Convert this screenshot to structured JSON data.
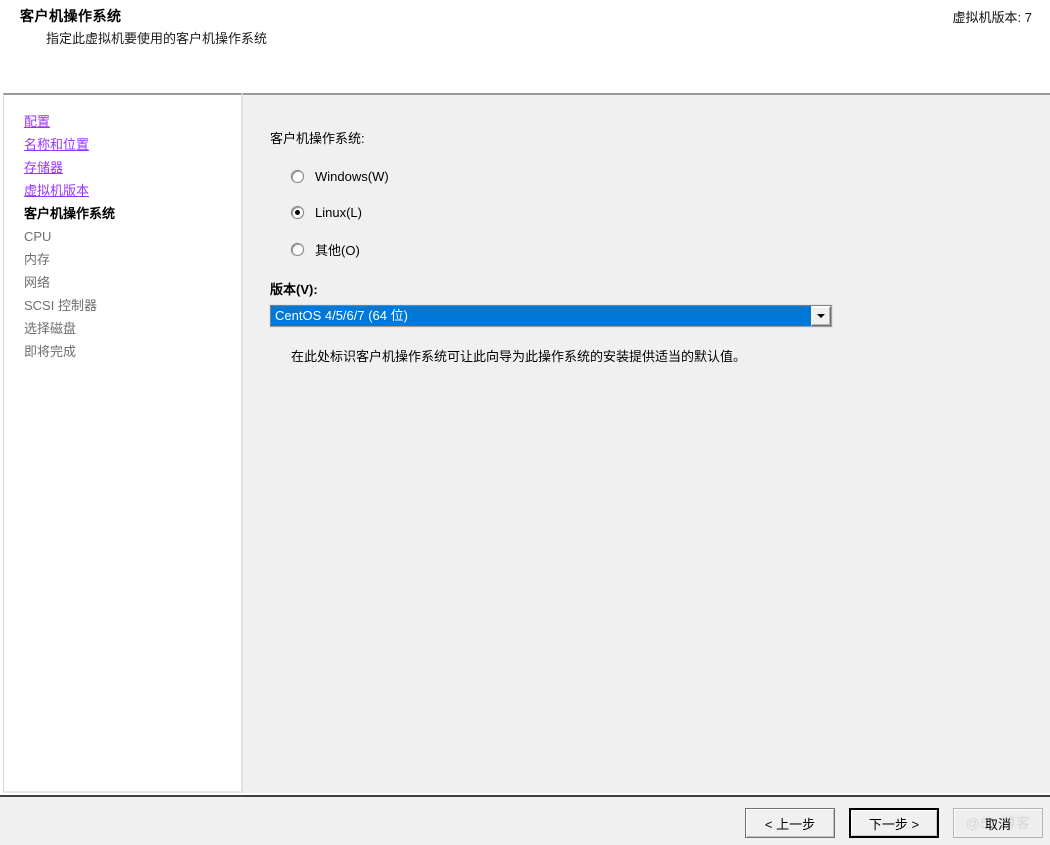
{
  "header": {
    "title": "客户机操作系统",
    "subtitle": "指定此虚拟机要使用的客户机操作系统",
    "version_label": "虚拟机版本: 7"
  },
  "sidebar": {
    "items": [
      {
        "label": "配置",
        "state": "link"
      },
      {
        "label": "名称和位置",
        "state": "link"
      },
      {
        "label": "存储器",
        "state": "link"
      },
      {
        "label": "虚拟机版本",
        "state": "link"
      },
      {
        "label": "客户机操作系统",
        "state": "current"
      },
      {
        "label": "CPU",
        "state": "plain"
      },
      {
        "label": "内存",
        "state": "plain"
      },
      {
        "label": "网络",
        "state": "plain"
      },
      {
        "label": "SCSI 控制器",
        "state": "plain"
      },
      {
        "label": "选择磁盘",
        "state": "plain"
      },
      {
        "label": "即将完成",
        "state": "plain"
      }
    ]
  },
  "main": {
    "os_group_label": "客户机操作系统:",
    "radios": [
      {
        "label": "Windows(W)",
        "checked": false
      },
      {
        "label": "Linux(L)",
        "checked": true
      },
      {
        "label": "其他(O)",
        "checked": false
      }
    ],
    "version_label": "版本(V):",
    "version_value": "CentOS 4/5/6/7 (64 位)",
    "hint": "在此处标识客户机操作系统可让此向导为此操作系统的安装提供适当的默认值。"
  },
  "footer": {
    "back_label": "< 上一步",
    "next_label": "下一步 >",
    "cancel_label": "取消",
    "watermark": "@51  博客"
  },
  "colors": {
    "accent_blue": "#0078d7",
    "link_purple": "#9933ff",
    "panel_gray": "#f0f0f0"
  }
}
